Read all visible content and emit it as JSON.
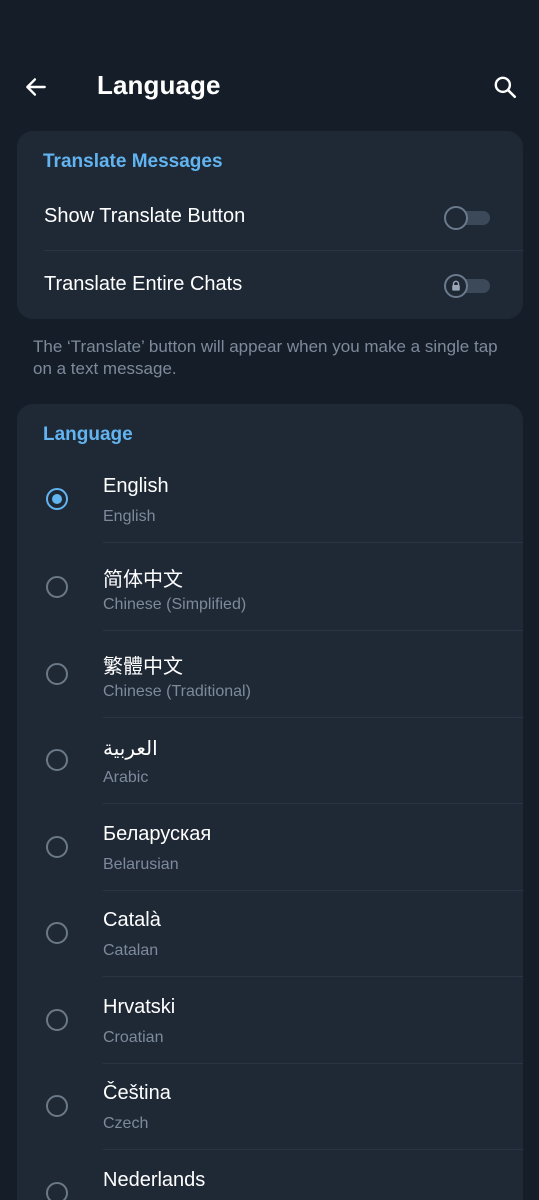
{
  "header": {
    "title": "Language",
    "back_icon": "arrow-left-icon",
    "search_icon": "search-icon"
  },
  "translate_section": {
    "title": "Translate Messages",
    "rows": [
      {
        "label": "Show Translate Button",
        "enabled": false,
        "locked": false
      },
      {
        "label": "Translate Entire Chats",
        "enabled": false,
        "locked": true
      }
    ],
    "footnote": "The ‘Translate’ button will appear when you make a single tap on a text message."
  },
  "language_section": {
    "title": "Language",
    "selected_index": 0,
    "items": [
      {
        "native": "English",
        "english": "English"
      },
      {
        "native": "简体中文",
        "english": "Chinese (Simplified)"
      },
      {
        "native": "繁體中文",
        "english": "Chinese (Traditional)"
      },
      {
        "native": "العربية",
        "english": "Arabic"
      },
      {
        "native": "Беларуская",
        "english": "Belarusian"
      },
      {
        "native": "Català",
        "english": "Catalan"
      },
      {
        "native": "Hrvatski",
        "english": "Croatian"
      },
      {
        "native": "Čeština",
        "english": "Czech"
      },
      {
        "native": "Nederlands",
        "english": ""
      }
    ]
  },
  "colors": {
    "background": "#151d28",
    "card": "#1f2936",
    "accent": "#62b4f0",
    "secondary_text": "#7d8a9b"
  }
}
